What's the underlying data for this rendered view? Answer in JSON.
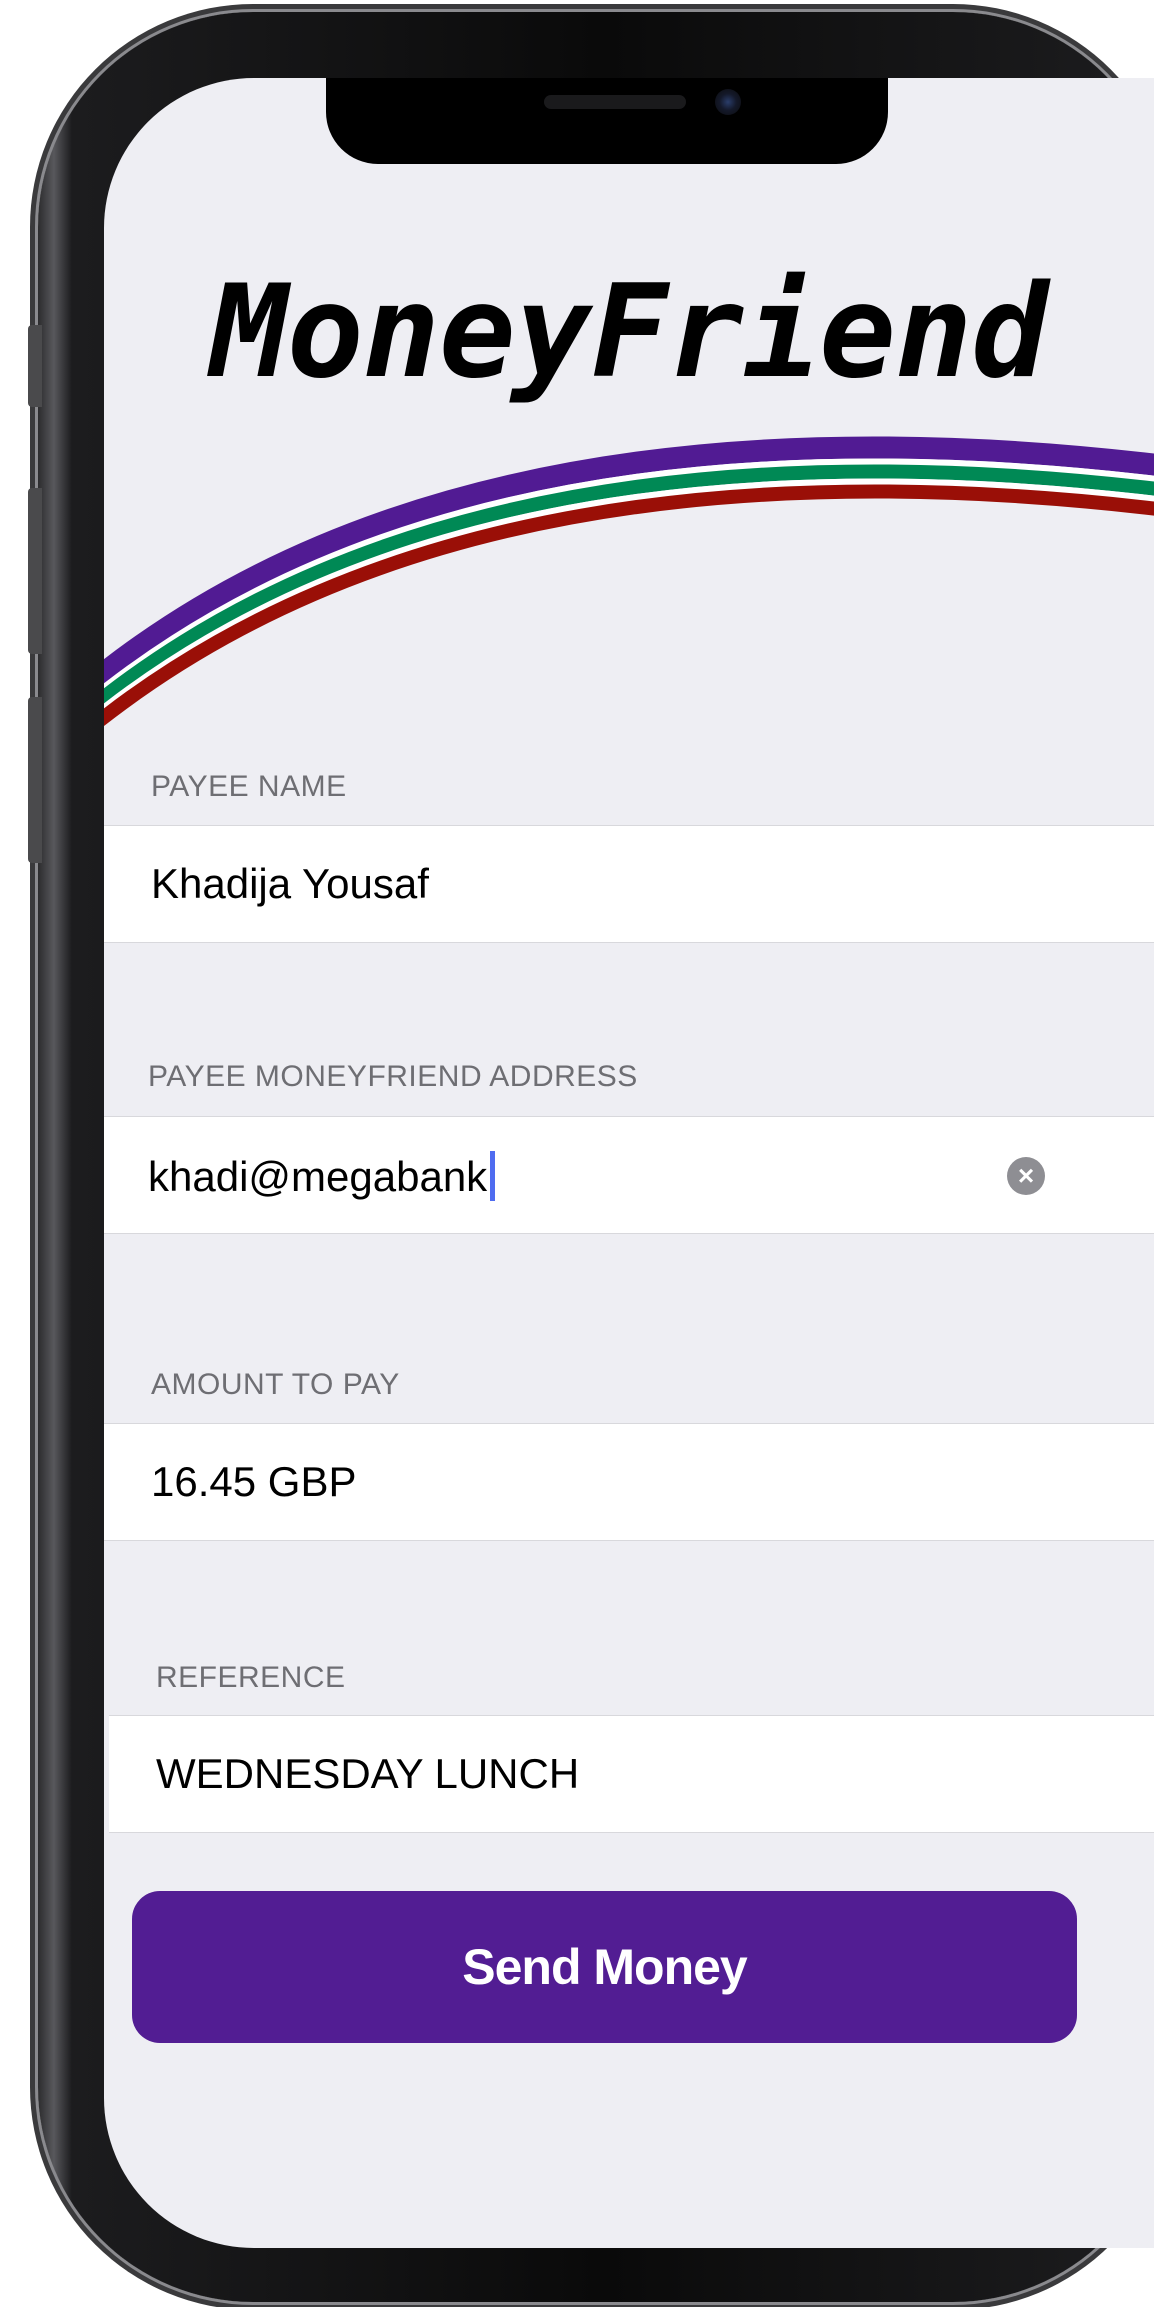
{
  "app": {
    "title": "MoneyFriend",
    "brand_stripe_colors": [
      "#511b93",
      "#008955",
      "#9a0f07"
    ],
    "accent": "#521d93"
  },
  "form": {
    "payee_name": {
      "label": "PAYEE NAME",
      "value": "Khadija Yousaf"
    },
    "payee_address": {
      "label": "PAYEE MONEYFRIEND ADDRESS",
      "value": "khadi@megabank",
      "clear_icon": "clear-circle-icon"
    },
    "amount": {
      "label": "AMOUNT TO PAY",
      "value": "16.45 GBP"
    },
    "reference": {
      "label": "REFERENCE",
      "value": "WEDNESDAY LUNCH"
    }
  },
  "actions": {
    "send_label": "Send Money"
  }
}
